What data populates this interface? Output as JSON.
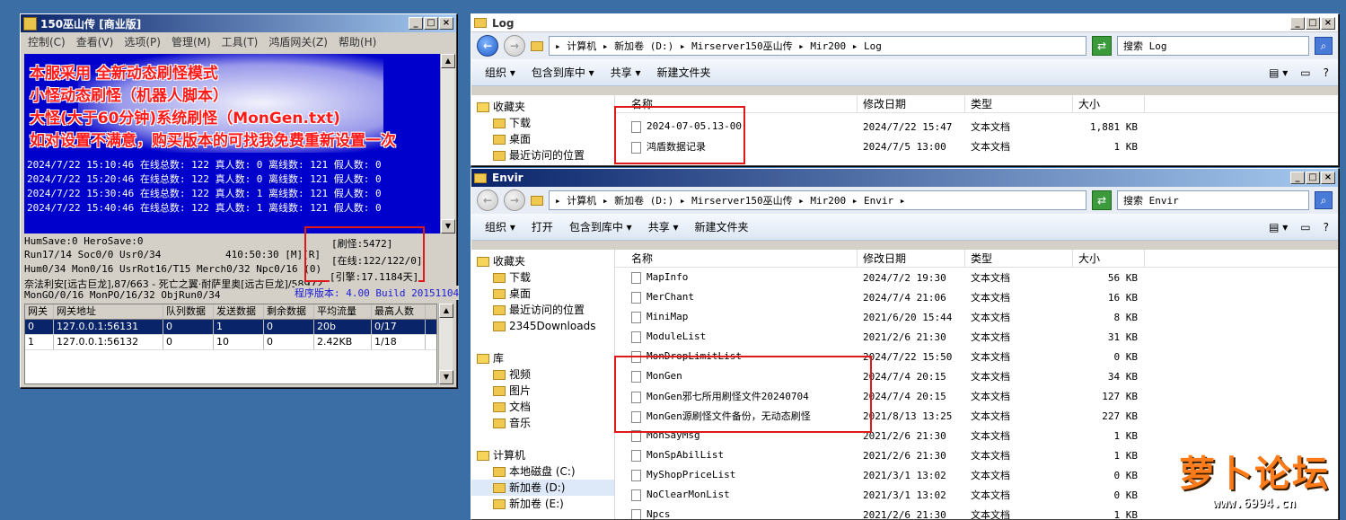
{
  "app": {
    "title": "150巫山传 [商业版]",
    "menu": [
      "控制(C)",
      "查看(V)",
      "选项(P)",
      "管理(M)",
      "工具(T)",
      "鸿盾网关(Z)",
      "帮助(H)"
    ],
    "promo": [
      "本服采用 全新动态刷怪模式",
      "小怪动态刷怪（机器人脚本）",
      "大怪(大于60分钟)系统刷怪（MonGen.txt)",
      "如对设置不满意，购买版本的可找我免费重新设置一次"
    ],
    "log": [
      "2024/7/22 15:10:46 在线总数: 122 真人数: 0 离线数: 121 假人数: 0",
      "2024/7/22 15:20:46 在线总数: 122 真人数: 0 离线数: 121 假人数: 0",
      "2024/7/22 15:30:46 在线总数: 122 真人数: 1 离线数: 121 假人数: 0",
      "2024/7/22 15:40:46 在线总数: 122 真人数: 1 离线数: 121 假人数: 0"
    ],
    "stats": {
      "l1": "HumSave:0 HeroSave:0",
      "l2": "Run17/14 Soc0/0 Usr0/34",
      "l2b": "410:50:30 [M][R]",
      "l3": "Hum0/34 Mon0/16 UsrRot16/T15 Merch0/32 Npc0/16 (0)",
      "l4": "奈法利安[远古巨龙],87/663 - 死亡之翼·耐萨里奥[远古巨龙]/58972",
      "l5": "MonGO/0/16 MonPO/16/32 ObjRun0/34",
      "version": "程序版本: 4.00 Build 20151104"
    },
    "box": [
      "[刷怪:5472]",
      "[在线:122/122/0]",
      "[引擎:17.1184天]"
    ],
    "grid": {
      "headers": [
        "网关",
        "网关地址",
        "队列数据",
        "发送数据",
        "剩余数据",
        "平均流量",
        "最高人数"
      ],
      "rows": [
        [
          "0",
          "127.0.0.1:56131",
          "0",
          "1",
          "0",
          "20b",
          "0/17"
        ],
        [
          "1",
          "127.0.0.1:56132",
          "0",
          "10",
          "0",
          "2.42KB",
          "1/18"
        ]
      ]
    }
  },
  "log_win": {
    "title": "Log",
    "address": "▸ 计算机 ▸ 新加卷 (D:) ▸ Mirserver150巫山传 ▸ Mir200 ▸ Log",
    "search": "搜索 Log",
    "tools": [
      "组织 ▾",
      "包含到库中 ▾",
      "共享 ▾",
      "新建文件夹"
    ],
    "nav": [
      {
        "t": "收藏夹",
        "top": true
      },
      {
        "t": "下载"
      },
      {
        "t": "桌面"
      },
      {
        "t": "最近访问的位置"
      }
    ],
    "headers": [
      "名称",
      "修改日期",
      "类型",
      "大小"
    ],
    "files": [
      [
        "2024-07-05.13-00",
        "2024/7/22 15:47",
        "文本文档",
        "1,881 KB"
      ],
      [
        "鸿盾数据记录",
        "2024/7/5 13:00",
        "文本文档",
        "1 KB"
      ]
    ]
  },
  "envir_win": {
    "title": "Envir",
    "address": "▸ 计算机 ▸ 新加卷 (D:) ▸ Mirserver150巫山传 ▸ Mir200 ▸ Envir ▸",
    "search": "搜索 Envir",
    "tools": [
      "组织 ▾",
      "打开",
      "包含到库中 ▾",
      "共享 ▾",
      "新建文件夹"
    ],
    "nav": [
      {
        "t": "收藏夹",
        "top": true
      },
      {
        "t": "下载"
      },
      {
        "t": "桌面"
      },
      {
        "t": "最近访问的位置"
      },
      {
        "t": "2345Downloads"
      },
      {
        "t": ""
      },
      {
        "t": "库",
        "top": true
      },
      {
        "t": "视频"
      },
      {
        "t": "图片"
      },
      {
        "t": "文档"
      },
      {
        "t": "音乐"
      },
      {
        "t": ""
      },
      {
        "t": "计算机",
        "top": true
      },
      {
        "t": "本地磁盘 (C:)"
      },
      {
        "t": "新加卷 (D:)",
        "sel": true
      },
      {
        "t": "新加卷 (E:)"
      }
    ],
    "headers": [
      "名称",
      "修改日期",
      "类型",
      "大小"
    ],
    "files": [
      [
        "MapInfo",
        "2024/7/2 19:30",
        "文本文档",
        "56 KB"
      ],
      [
        "MerChant",
        "2024/7/4 21:06",
        "文本文档",
        "16 KB"
      ],
      [
        "MiniMap",
        "2021/6/20 15:44",
        "文本文档",
        "8 KB"
      ],
      [
        "ModuleList",
        "2021/2/6 21:30",
        "文本文档",
        "31 KB"
      ],
      [
        "MonDropLimitList",
        "2024/7/22 15:50",
        "文本文档",
        "0 KB"
      ],
      [
        "MonGen",
        "2024/7/4 20:15",
        "文本文档",
        "34 KB"
      ],
      [
        "MonGen邪七所用刷怪文件20240704",
        "2024/7/4 20:15",
        "文本文档",
        "127 KB"
      ],
      [
        "MonGen源刷怪文件备份，无动态刷怪",
        "2021/8/13 13:25",
        "文本文档",
        "227 KB"
      ],
      [
        "MonSayMsg",
        "2021/2/6 21:30",
        "文本文档",
        "1 KB"
      ],
      [
        "MonSpAbilList",
        "2021/2/6 21:30",
        "文本文档",
        "1 KB"
      ],
      [
        "MyShopPriceList",
        "2021/3/1 13:02",
        "文本文档",
        "0 KB"
      ],
      [
        "NoClearMonList",
        "2021/3/1 13:02",
        "文本文档",
        "0 KB"
      ],
      [
        "Npcs",
        "2021/2/6 21:30",
        "文本文档",
        "1 KB"
      ]
    ]
  },
  "watermark": {
    "text": "萝卜论坛",
    "url": "www.6994.cn"
  }
}
